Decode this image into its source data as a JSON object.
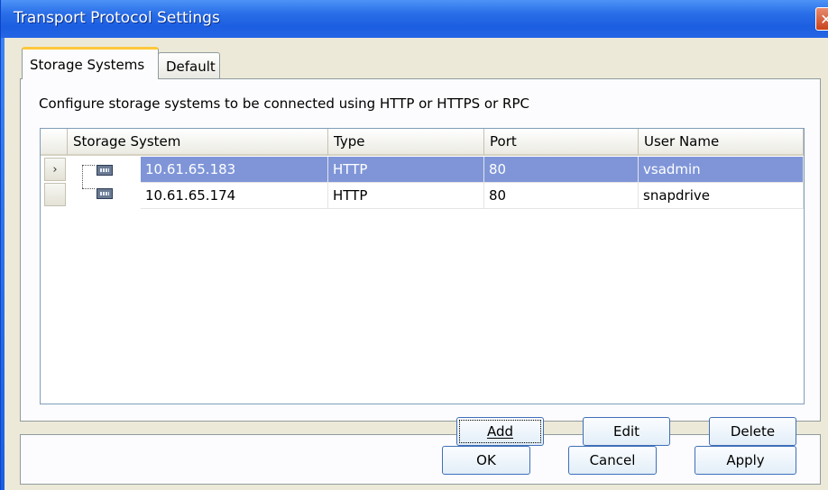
{
  "window": {
    "title": "Transport Protocol Settings"
  },
  "tabs": [
    {
      "label": "Storage Systems",
      "active": true
    },
    {
      "label": "Default",
      "active": false
    }
  ],
  "description": "Configure storage systems to be connected using  HTTP or HTTPS or RPC",
  "table": {
    "columns": [
      "Storage System",
      "Type",
      "Port",
      "User Name"
    ],
    "rows": [
      {
        "system": "10.61.65.183",
        "type": "HTTP",
        "port": "80",
        "user": "vsadmin",
        "selected": true
      },
      {
        "system": "10.61.65.174",
        "type": "HTTP",
        "port": "80",
        "user": "snapdrive",
        "selected": false
      }
    ],
    "current_row_marker": "›"
  },
  "grid_buttons": {
    "add": "Add",
    "edit": "Edit",
    "delete": "Delete"
  },
  "dialog_buttons": {
    "ok": "OK",
    "cancel": "Cancel",
    "apply": "Apply"
  },
  "icons": {
    "close": "close-icon",
    "server": "storage-server-icon"
  },
  "colors": {
    "selection": "#7f95d8",
    "titlebar": "#2a6fe8",
    "face": "#ece9d8"
  }
}
